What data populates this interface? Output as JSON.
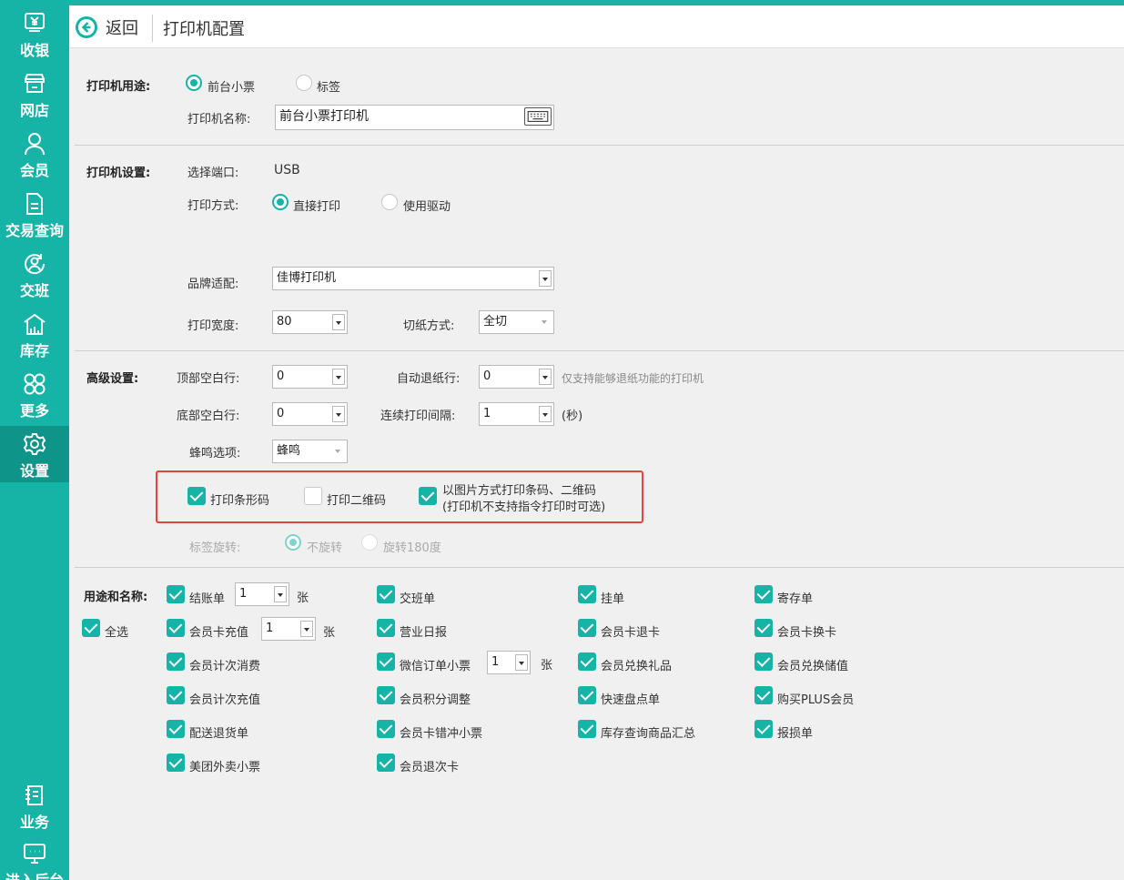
{
  "sidebar": {
    "items": [
      {
        "label": "收银",
        "icon": "yen-register-icon"
      },
      {
        "label": "网店",
        "icon": "store-icon"
      },
      {
        "label": "会员",
        "icon": "person-icon"
      },
      {
        "label": "交易查询",
        "icon": "document-icon"
      },
      {
        "label": "交班",
        "icon": "shift-handover-icon"
      },
      {
        "label": "库存",
        "icon": "warehouse-icon"
      },
      {
        "label": "更多",
        "icon": "more-grid-icon"
      },
      {
        "label": "设置",
        "icon": "gear-icon",
        "active": true
      },
      {
        "label": "业务",
        "icon": "business-book-icon"
      },
      {
        "label": "进入后台",
        "icon": "backend-monitor-icon"
      }
    ]
  },
  "header": {
    "back_label": "返回",
    "title": "打印机配置"
  },
  "usage": {
    "label": "打印机用途:",
    "options": [
      "前台小票",
      "标签"
    ],
    "selected": "前台小票",
    "name_label": "打印机名称:",
    "name_value": "前台小票打印机"
  },
  "settings": {
    "label": "打印机设置:",
    "port_label": "选择端口:",
    "port_value": "USB",
    "mode_label": "打印方式:",
    "mode_options": [
      "直接打印",
      "使用驱动"
    ],
    "mode_selected": "直接打印",
    "brand_label": "品牌适配:",
    "brand_value": "佳博打印机",
    "width_label": "打印宽度:",
    "width_value": "80",
    "cut_label": "切纸方式:",
    "cut_value": "全切"
  },
  "advanced": {
    "label": "高级设置:",
    "top_blank_label": "顶部空白行:",
    "top_blank_value": "0",
    "auto_retract_label": "自动退纸行:",
    "auto_retract_value": "0",
    "auto_retract_hint": "仅支持能够退纸功能的打印机",
    "bottom_blank_label": "底部空白行:",
    "bottom_blank_value": "0",
    "interval_label": "连续打印间隔:",
    "interval_value": "1",
    "interval_unit": "(秒)",
    "beep_label": "蜂鸣选项:",
    "beep_value": "蜂鸣",
    "print_barcode": {
      "label": "打印条形码",
      "checked": true
    },
    "print_qrcode": {
      "label": "打印二维码",
      "checked": false
    },
    "print_as_image": {
      "label_line1": "以图片方式打印条码、二维码",
      "label_line2": "(打印机不支持指令打印时可选)",
      "checked": true
    },
    "rotate_label": "标签旋转:",
    "rotate_options": [
      "不旋转",
      "旋转180度"
    ],
    "rotate_selected": "不旋转"
  },
  "purposes": {
    "label": "用途和名称:",
    "select_all": "全选",
    "unit": "张",
    "items": [
      {
        "label": "结账单",
        "checked": true,
        "count": "1"
      },
      {
        "label": "交班单",
        "checked": true
      },
      {
        "label": "挂单",
        "checked": true
      },
      {
        "label": "寄存单",
        "checked": true
      },
      {
        "label": "会员卡充值",
        "checked": true,
        "count": "1"
      },
      {
        "label": "营业日报",
        "checked": true
      },
      {
        "label": "会员卡退卡",
        "checked": true
      },
      {
        "label": "会员卡换卡",
        "checked": true
      },
      {
        "label": "会员计次消费",
        "checked": true
      },
      {
        "label": "微信订单小票",
        "checked": true,
        "count": "1"
      },
      {
        "label": "会员兑换礼品",
        "checked": true
      },
      {
        "label": "会员兑换储值",
        "checked": true
      },
      {
        "label": "会员计次充值",
        "checked": true
      },
      {
        "label": "会员积分调整",
        "checked": true
      },
      {
        "label": "快速盘点单",
        "checked": true
      },
      {
        "label": "购买PLUS会员",
        "checked": true
      },
      {
        "label": "配送退货单",
        "checked": true
      },
      {
        "label": "会员卡错冲小票",
        "checked": true
      },
      {
        "label": "库存查询商品汇总",
        "checked": true
      },
      {
        "label": "报损单",
        "checked": true
      },
      {
        "label": "美团外卖小票",
        "checked": true
      },
      {
        "label": "会员退次卡",
        "checked": true
      }
    ]
  },
  "colors": {
    "accent": "#16b3a7",
    "highlight_border": "#e8413d"
  }
}
